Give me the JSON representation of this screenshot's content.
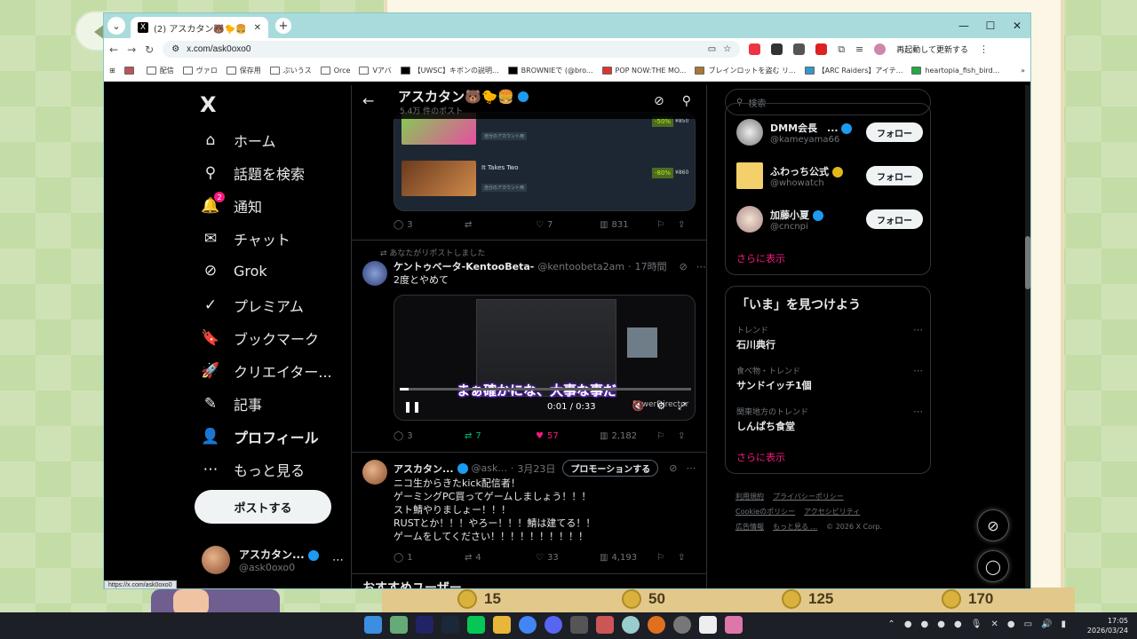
{
  "browser": {
    "tab_title": "(2) アスカタン🐻🐤🍔（@ask0x",
    "url": "x.com/ask0oxo0",
    "restart_label": "再起動して更新する",
    "bookmarks": [
      "",
      "配信",
      "ヴァロ",
      "保存用",
      "ぷいうス",
      "Orce",
      "Vアバ",
      "【UWSC】キボンの説明...",
      "BROWNIEで (@bro...",
      "POP NOW:THE MO...",
      "ブレインロットを盗む リ...",
      "【ARC Raiders】アイテ...",
      "heartopia_fish_bird..."
    ],
    "status_url": "https://x.com/ask0oxo0"
  },
  "background": {
    "coins": [
      "15",
      "50",
      "125",
      "170"
    ]
  },
  "sidebar": {
    "logo": "X",
    "items": [
      {
        "label": "ホーム",
        "icon": "home-icon",
        "glyph": "⌂"
      },
      {
        "label": "話題を検索",
        "icon": "search-icon",
        "glyph": "⚲"
      },
      {
        "label": "通知",
        "icon": "bell-icon",
        "glyph": "🔔",
        "badge": "2"
      },
      {
        "label": "チャット",
        "icon": "mail-icon",
        "glyph": "✉"
      },
      {
        "label": "Grok",
        "icon": "grok-icon",
        "glyph": "⊘"
      },
      {
        "label": "プレミアム",
        "icon": "premium-icon",
        "glyph": "✓"
      },
      {
        "label": "ブックマーク",
        "icon": "bookmark-icon",
        "glyph": "🔖"
      },
      {
        "label": "クリエイター...",
        "icon": "rocket-icon",
        "glyph": "🚀"
      },
      {
        "label": "記事",
        "icon": "article-icon",
        "glyph": "✎"
      },
      {
        "label": "プロフィール",
        "icon": "profile-icon",
        "glyph": "👤"
      },
      {
        "label": "もっと見る",
        "icon": "more-icon",
        "glyph": "⋯"
      }
    ],
    "post_button": "ポストする",
    "profile_name": "アスカタン...",
    "profile_handle": "@ask0oxo0"
  },
  "timeline": {
    "header_title": "アスカタン🐻🐤🍔",
    "header_sub": "5.4万 件のポスト",
    "card_games": [
      {
        "title": "",
        "tag": "自分のアカウント用",
        "discount": "-50%",
        "price": "¥850"
      },
      {
        "title": "It Takes Two",
        "tag": "自分のアカウント用",
        "discount": "-80%",
        "price": "¥860"
      }
    ],
    "tweet1_actions": {
      "reply": "3",
      "repost": "",
      "like": "7",
      "views": "831"
    },
    "repost_note": "あなたがリポストしました",
    "tweet2": {
      "name": "ケントゥベータ-KentooBeta-",
      "handle": "@kentoobeta2am",
      "time": "17時間",
      "text": "2度とやめて",
      "subtitle": "まぁ確かにな、大事な事だ",
      "video_time": "0:01 / 0:33",
      "watermark": "PowerDirector",
      "actions": {
        "reply": "3",
        "repost": "7",
        "like": "57",
        "views": "2,182"
      }
    },
    "tweet3": {
      "name": "アスカタン...",
      "handle": "@ask...",
      "time": "3月23日",
      "promote": "プロモーションする",
      "text": "ニコ生からきたkick配信者！\nゲーミングPC買ってゲームしましょう！！！\nスト鯖やりましょー！！！\nRUSTとか！！！やろー！！！鯖は建てる！！\nゲームをしてください！！！！！！！！！！",
      "actions": {
        "reply": "1",
        "repost": "4",
        "like": "33",
        "views": "4,193"
      }
    },
    "recommend_title": "おすすめユーザー"
  },
  "right": {
    "search_placeholder": "検索",
    "users": [
      {
        "name": "DMM会長　...",
        "handle": "@kameyama66",
        "follow": "フォロー",
        "badge": "blue"
      },
      {
        "name": "ふわっち公式",
        "handle": "@whowatch",
        "follow": "フォロー",
        "badge": "gold"
      },
      {
        "name": "加藤小夏",
        "handle": "@cncnpi",
        "follow": "フォロー",
        "badge": "blue"
      }
    ],
    "show_more": "さらに表示",
    "trend_title": "「いま」を見つけよう",
    "trends": [
      {
        "category": "トレンド",
        "topic": "石川典行"
      },
      {
        "category": "食べ物・トレンド",
        "topic": "サンドイッチ1個"
      },
      {
        "category": "関東地方のトレンド",
        "topic": "しんぱち食堂"
      }
    ],
    "show_more2": "さらに表示",
    "footer": [
      "利用規約",
      "プライバシーポリシー",
      "Cookieのポリシー",
      "アクセシビリティ",
      "広告情報",
      "もっと見る ...",
      "© 2026 X Corp."
    ]
  },
  "taskbar": {
    "time": "17:05",
    "date": "2026/03/24"
  },
  "colors": {
    "accent": "#1d9bf0",
    "like": "#f91880",
    "repost": "#00ba7c",
    "steam_green": "#4c6b22"
  }
}
